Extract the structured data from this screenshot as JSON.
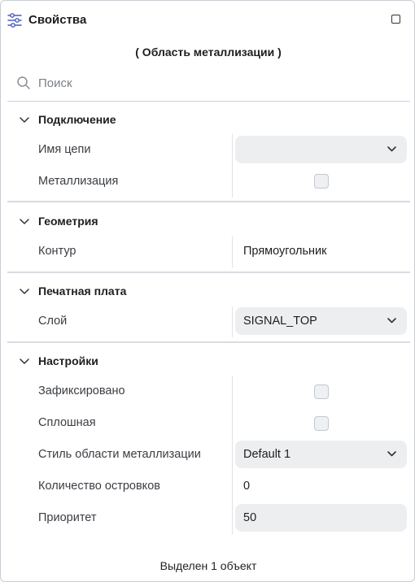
{
  "header": {
    "title": "Свойства"
  },
  "subtitle": "( Область металлизации )",
  "search": {
    "placeholder": "Поиск",
    "value": ""
  },
  "sections": {
    "connection": {
      "title": "Подключение",
      "rows": {
        "net_name": {
          "label": "Имя цепи",
          "value": ""
        },
        "metallization": {
          "label": "Металлизация",
          "checked": false
        }
      }
    },
    "geometry": {
      "title": "Геометрия",
      "rows": {
        "contour": {
          "label": "Контур",
          "value": "Прямоугольник"
        }
      }
    },
    "pcb": {
      "title": "Печатная плата",
      "rows": {
        "layer": {
          "label": "Слой",
          "value": "SIGNAL_TOP"
        }
      }
    },
    "settings": {
      "title": "Настройки",
      "rows": {
        "fixed": {
          "label": "Зафиксировано",
          "checked": false
        },
        "solid": {
          "label": "Сплошная",
          "checked": false
        },
        "style": {
          "label": "Стиль области металлизации",
          "value": "Default 1"
        },
        "islands": {
          "label": "Количество островков",
          "value": "0"
        },
        "priority": {
          "label": "Приоритет",
          "value": "50"
        }
      }
    }
  },
  "footer": {
    "status": "Выделен 1 объект"
  },
  "icons": {
    "header": "sliders-icon",
    "maximize": "square-icon",
    "search": "search-icon",
    "collapse": "chevron-down-icon"
  }
}
